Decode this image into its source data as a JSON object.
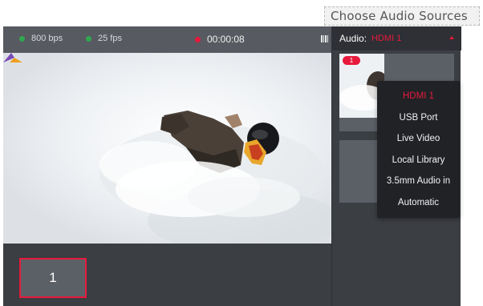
{
  "tooltip": {
    "text": "Choose Audio Sources"
  },
  "status": {
    "bitrate": "800 bps",
    "fps": "25 fps",
    "record_time": "00:00:08",
    "colors": {
      "ok": "#2fa84f",
      "recording": "#e8193c"
    }
  },
  "icons": {
    "signal": "signal-bars-icon",
    "dropdown": "chevron-up-icon"
  },
  "audio": {
    "label": "Audio:",
    "selected": "HDMI 1",
    "accent_color": "#e8193c",
    "options": [
      "HDMI 1",
      "USB Port",
      "Live Video",
      "Local Library",
      "3.5mm Audio in",
      "Automatic"
    ]
  },
  "sources": {
    "main_tile_label": "1",
    "thumbnail_badge": "1"
  }
}
